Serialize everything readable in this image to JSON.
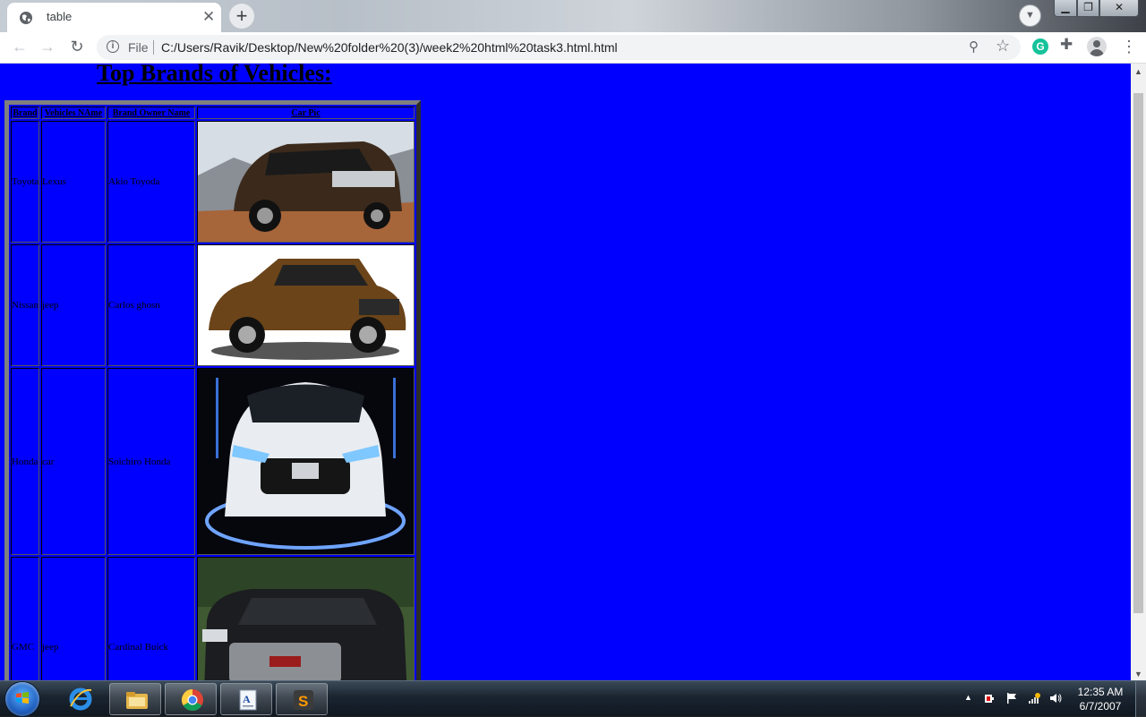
{
  "browser": {
    "tab_title": "table",
    "tab_close_glyph": "✕",
    "new_tab_glyph": "+",
    "scheme_label": "File",
    "url": "C:/Users/Ravik/Desktop/New%20folder%20(3)/week2%20html%20task3.html.html",
    "nav_icons": [
      "back-arrow-icon",
      "forward-arrow-icon",
      "reload-icon"
    ],
    "window_controls": [
      "minimize",
      "maximize",
      "close"
    ]
  },
  "page": {
    "heading": "Top Brands of Vehicles:",
    "background_color": "#0000ff",
    "table": {
      "headers": [
        "Brand",
        "Vehicles NAme",
        "Brand Owner Name",
        "Car Pic"
      ],
      "rows": [
        {
          "brand": "Toyota",
          "vehicle": "Lexus",
          "owner": "Akio Toyoda",
          "car_pic": "brown-suv-photo",
          "pic_height": 134
        },
        {
          "brand": "Nissan",
          "vehicle": "jeep",
          "owner": "Carlos ghosn",
          "car_pic": "bronze-suv-photo",
          "pic_height": 134
        },
        {
          "brand": "Honda",
          "vehicle": "car",
          "owner": "Soichiro Honda",
          "car_pic": "white-sedan-front-photo",
          "pic_height": 207
        },
        {
          "brand": "GMC",
          "vehicle": "jeep",
          "owner": "Cardinal Buick",
          "car_pic": "black-suv-photo",
          "pic_height": 200
        }
      ]
    }
  },
  "taskbar": {
    "pinned": [
      "internet-explorer",
      "file-explorer",
      "google-chrome",
      "wordpad",
      "sublime-text"
    ],
    "active": "google-chrome",
    "clock_time": "12:35 AM",
    "clock_date": "6/7/2007"
  }
}
